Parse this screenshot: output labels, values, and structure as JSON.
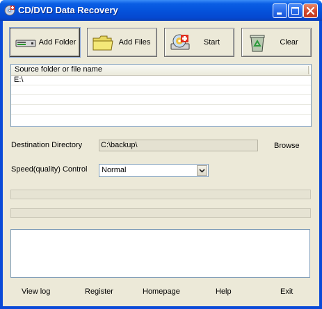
{
  "window": {
    "title": "CD/DVD Data Recovery",
    "controls": {
      "minimize": "minimize",
      "maximize": "maximize",
      "close": "close"
    }
  },
  "toolbar": {
    "add_folder": "Add Folder",
    "add_files": "Add Files",
    "start": "Start",
    "clear": "Clear"
  },
  "source_list": {
    "header": "Source folder or file name",
    "items": [
      "E:\\",
      "",
      "",
      "",
      ""
    ]
  },
  "destination": {
    "label": "Destination Directory",
    "value": "C:\\backup\\",
    "browse": "Browse"
  },
  "speed": {
    "label": "Speed(quality) Control",
    "selected": "Normal"
  },
  "progress": {
    "bar1": 0,
    "bar2": 0
  },
  "log": {
    "text": ""
  },
  "footer": {
    "view_log": "View log",
    "register": "Register",
    "homepage": "Homepage",
    "help": "Help",
    "exit": "Exit"
  },
  "colors": {
    "titlebar": "#0553dc",
    "client_bg": "#ece9d8",
    "list_border": "#7f9db9"
  }
}
